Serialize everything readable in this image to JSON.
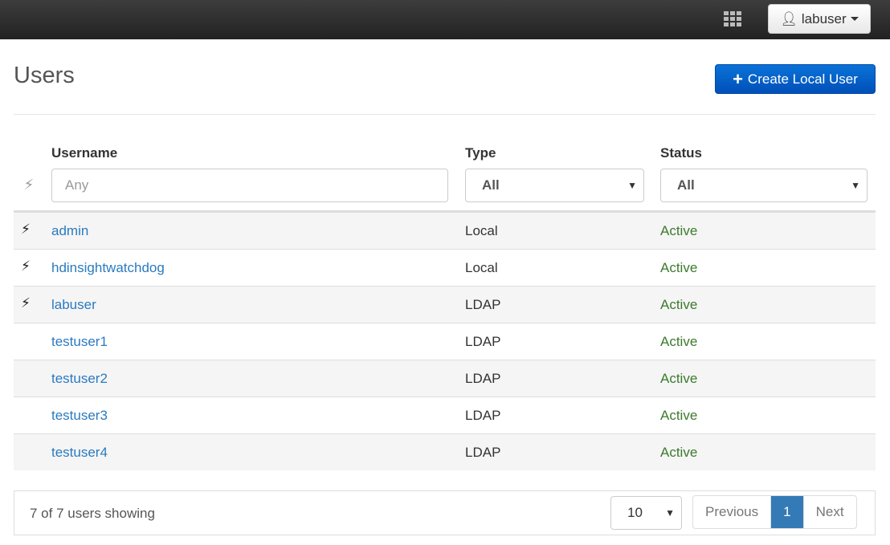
{
  "topbar": {
    "apps_icon": "grid-icon",
    "user_label": "labuser",
    "user_icon": "user-icon"
  },
  "page": {
    "title": "Users",
    "create_label": "Create Local User"
  },
  "table": {
    "headers": {
      "username": "Username",
      "type": "Type",
      "status": "Status"
    },
    "filters": {
      "username_placeholder": "Any",
      "type": "All",
      "status": "All"
    },
    "rows": [
      {
        "username": "admin",
        "type": "Local",
        "status": "Active",
        "admin": true
      },
      {
        "username": "hdinsightwatchdog",
        "type": "Local",
        "status": "Active",
        "admin": true
      },
      {
        "username": "labuser",
        "type": "LDAP",
        "status": "Active",
        "admin": true
      },
      {
        "username": "testuser1",
        "type": "LDAP",
        "status": "Active",
        "admin": false
      },
      {
        "username": "testuser2",
        "type": "LDAP",
        "status": "Active",
        "admin": false
      },
      {
        "username": "testuser3",
        "type": "LDAP",
        "status": "Active",
        "admin": false
      },
      {
        "username": "testuser4",
        "type": "LDAP",
        "status": "Active",
        "admin": false
      }
    ]
  },
  "footer": {
    "count": "7 of 7 users showing",
    "page_size": "10",
    "previous": "Previous",
    "page": "1",
    "next": "Next"
  },
  "colors": {
    "link": "#2a7ac0",
    "status_active": "#3c7a2d",
    "primary": "#0a64c8"
  }
}
